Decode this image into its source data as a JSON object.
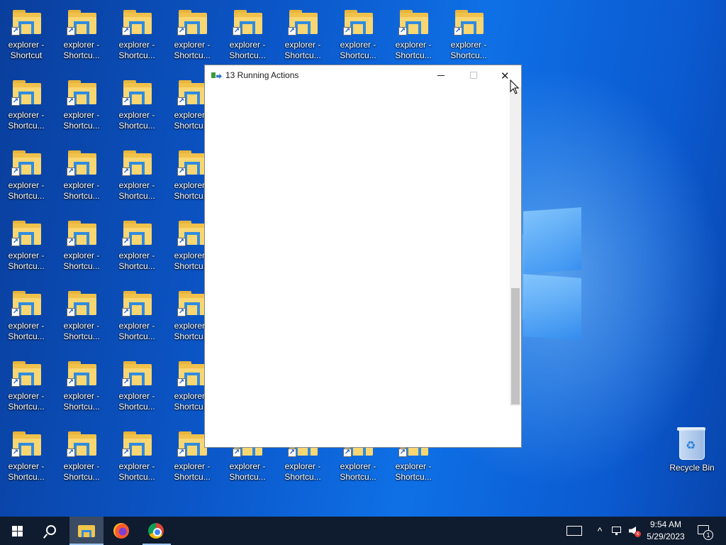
{
  "desktop": {
    "icons": [
      {
        "label": "explorer -\nShortcut"
      },
      {
        "label": "explorer -\nShortcu..."
      }
    ],
    "recycle_bin": {
      "label": "Recycle Bin"
    }
  },
  "dialog": {
    "title": "13 Running Actions",
    "icon": "running-actions-icon",
    "minimize_glyph": "—",
    "close_glyph": "✕"
  },
  "taskbar": {
    "apps": [
      "start-icon",
      "search-icon",
      "file-explorer-icon",
      "firefox-icon",
      "chrome-icon"
    ],
    "tray": {
      "time": "9:54 AM",
      "date": "5/29/2023",
      "chevron": "^",
      "mute_mark": "x",
      "notification_count": "1"
    }
  },
  "colors": {
    "taskbar": "#0f1b2e",
    "desktop_blue": "#0b57c9",
    "folder_yellow": "#f8d672"
  }
}
